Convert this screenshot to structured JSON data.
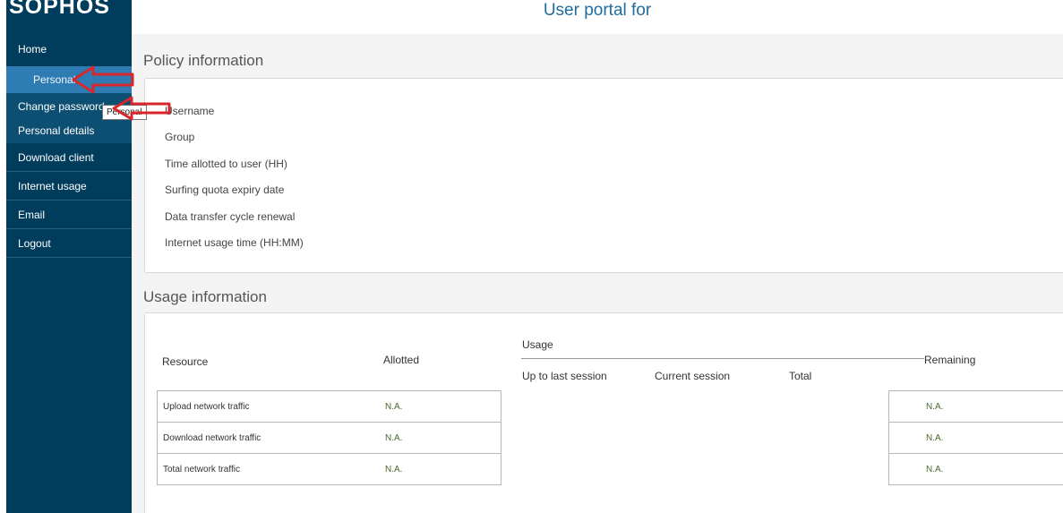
{
  "app": {
    "logo": "SOPHOS",
    "title": "User portal for"
  },
  "sidebar": {
    "items": [
      {
        "label": "Home"
      },
      {
        "label": "Personal"
      },
      {
        "label": "Change password"
      },
      {
        "label": "Personal details"
      },
      {
        "label": "Download client"
      },
      {
        "label": "Internet usage"
      },
      {
        "label": "Email"
      },
      {
        "label": "Logout"
      }
    ]
  },
  "tooltip": {
    "text": "Personal"
  },
  "policy": {
    "title": "Policy information",
    "rows": [
      "Username",
      "Group",
      "Time allotted to user (HH)",
      "Surfing quota expiry date",
      "Data transfer cycle renewal",
      "Internet usage time (HH:MM)"
    ]
  },
  "usage": {
    "title": "Usage information",
    "headers": {
      "resource": "Resource",
      "allotted": "Allotted",
      "usage": "Usage",
      "up_to_last": "Up to last session",
      "current": "Current session",
      "total": "Total",
      "remaining": "Remaining"
    },
    "rows": [
      {
        "resource": "Upload network traffic",
        "allotted": "N.A.",
        "remaining": "N.A."
      },
      {
        "resource": "Download network traffic",
        "allotted": "N.A.",
        "remaining": "N.A."
      },
      {
        "resource": "Total network traffic",
        "allotted": "N.A.",
        "remaining": "N.A."
      }
    ]
  },
  "colors": {
    "sidebar": "#003d5c",
    "active": "#2f7cb4",
    "title": "#1f6d9c",
    "annotation": "#d9262b",
    "na_value": "#4a6a2e"
  }
}
